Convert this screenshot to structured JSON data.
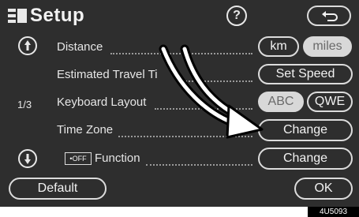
{
  "header": {
    "title": "Setup",
    "help_label": "?",
    "back_icon": "return-arrow-icon"
  },
  "page_indicator": "1/3",
  "rows": [
    {
      "label": "Distance"
    },
    {
      "label": "Estimated Travel Ti"
    },
    {
      "label": "Keyboard Layout"
    },
    {
      "label": "Time Zone"
    },
    {
      "label": "Function",
      "prefix": "•OFF"
    }
  ],
  "controls": {
    "km": "km",
    "miles": "miles",
    "set_speed": "Set Speed",
    "abc": "ABC",
    "qwe": "QWE",
    "change_time_zone": "Change",
    "change_function": "Change",
    "default": "Default",
    "ok": "OK"
  },
  "figure_code": "4U5093"
}
